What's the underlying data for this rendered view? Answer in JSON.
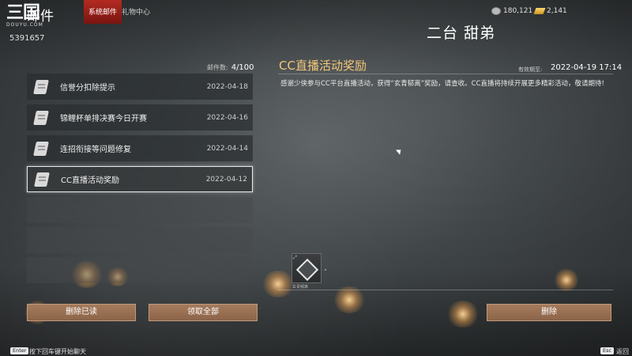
{
  "header": {
    "logo_text": "三国",
    "logo_overlay": "邮件",
    "logo_sub": "DOUYU.COM",
    "user_id": "5391657",
    "tabs": [
      {
        "label": "系统邮件",
        "active": true
      },
      {
        "label": "礼物中心",
        "active": false
      }
    ],
    "currencies": [
      {
        "icon": "silver-coin-icon",
        "value": "180,121"
      },
      {
        "icon": "gold-ingot-icon",
        "value": "2,141"
      }
    ],
    "streamer_label": "二台 甜弟"
  },
  "mail_list": {
    "count_label": "邮件数:",
    "count_value": "4/100",
    "items": [
      {
        "title": "信誉分扣除提示",
        "date": "2022-04-18",
        "selected": false
      },
      {
        "title": "锦鲤杯单排决赛今日开赛",
        "date": "2022-04-16",
        "selected": false
      },
      {
        "title": "连招衔接等问题修复",
        "date": "2022-04-14",
        "selected": false
      },
      {
        "title": "CC直播活动奖励",
        "date": "2022-04-12",
        "selected": true
      }
    ],
    "delete_read_label": "删除已读",
    "claim_all_label": "领取全部"
  },
  "mail_detail": {
    "title": "CC直播活动奖励",
    "expire_label": "有效期至:",
    "expire_value": "2022-04-19 17:14",
    "body": "感谢少侠参与CC平台直播活动，获得“玄青郁离”奖励，请查收。CC直播将持续开展更多精彩活动，敬请期待!",
    "reward": {
      "name": "玄青郁离",
      "icon": "reward-gem-icon"
    },
    "delete_label": "删除"
  },
  "footer": {
    "enter_key": "Enter",
    "enter_hint": "按下回车键开始聊天",
    "esc_key": "Esc",
    "esc_hint": "返回"
  },
  "colors": {
    "accent_red": "#9e2219",
    "title_gold": "#f2c77a",
    "button_bronze": "#9a7054"
  }
}
